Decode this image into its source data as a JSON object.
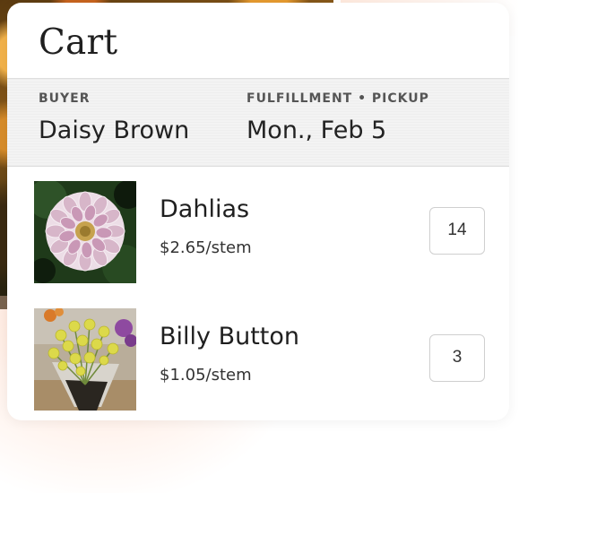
{
  "cart": {
    "title": "Cart"
  },
  "info": {
    "buyer_label": "BUYER",
    "buyer_name": "Daisy Brown",
    "fulfillment_label": "FULFILLMENT • PICKUP",
    "fulfillment_date": "Mon., Feb 5"
  },
  "items": [
    {
      "name": "Dahlias",
      "price": "$2.65/stem",
      "quantity": "14",
      "thumbnail_icon": "dahlia-photo"
    },
    {
      "name": "Billy Button",
      "price": "$1.05/stem",
      "quantity": "3",
      "thumbnail_icon": "billy-button-photo"
    }
  ],
  "colors": {
    "text_primary": "#1f1f1f",
    "label_gray": "#555555",
    "band_background": "#f3f3f3",
    "border": "#cfcfcf"
  }
}
